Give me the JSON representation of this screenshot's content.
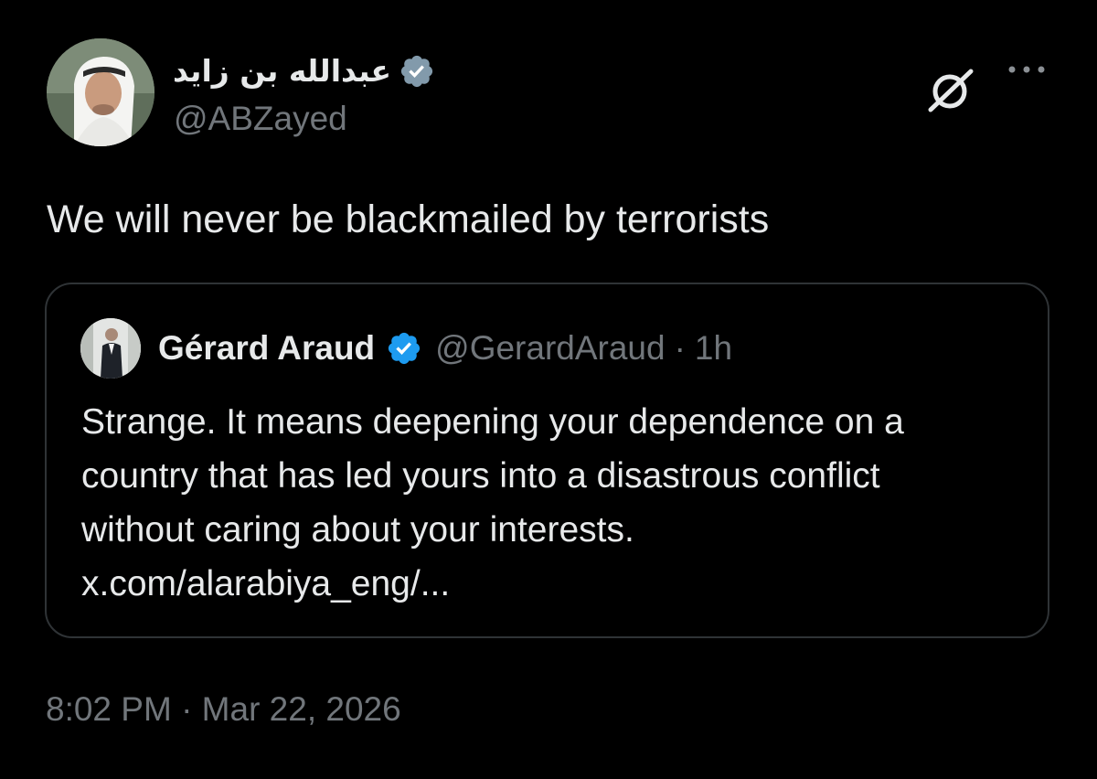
{
  "tweet": {
    "author": {
      "display_name": "عبدالله بن زايد",
      "handle": "@ABZayed",
      "verified": true,
      "avatar_icon": "profile-photo"
    },
    "actions": {
      "grok_icon": "grok-icon",
      "more_icon": "more-icon"
    },
    "text": "We will never be blackmailed by terrorists",
    "quote": {
      "author": {
        "display_name": "Gérard Araud",
        "handle": "@GerardAraud",
        "verified": true,
        "avatar_icon": "profile-photo"
      },
      "separator": "·",
      "time": "1h",
      "text_lines": [
        "Strange. It means deepening your dependence on a",
        "country that has led yours into a disastrous conflict",
        "without caring about your interests.",
        "x.com/alarabiya_eng/..."
      ]
    },
    "timestamp": "8:02 PM · Mar 22, 2026"
  },
  "colors": {
    "background": "#000000",
    "primary_text": "#e7e9ea",
    "secondary_text": "#71767b",
    "border": "#2f3336",
    "verified_badge": "#1d9bf0",
    "verified_badge_gray": "#829aab"
  }
}
